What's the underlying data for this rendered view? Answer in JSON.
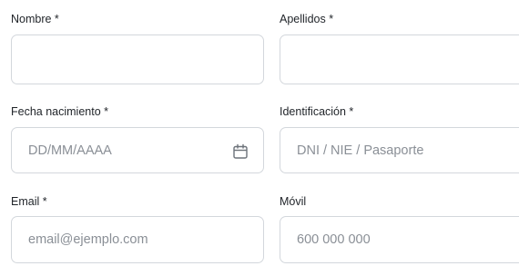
{
  "fields": {
    "nombre": {
      "label": "Nombre *",
      "value": "",
      "placeholder": ""
    },
    "apellidos": {
      "label": "Apellidos *",
      "value": "",
      "placeholder": ""
    },
    "fecha_nacimiento": {
      "label": "Fecha nacimiento *",
      "value": "",
      "placeholder": "DD/MM/AAAA",
      "icon": "calendar-icon"
    },
    "identificacion": {
      "label": "Identificación *",
      "value": "",
      "placeholder": "DNI / NIE / Pasaporte"
    },
    "email": {
      "label": "Email *",
      "value": "",
      "placeholder": "email@ejemplo.com"
    },
    "movil": {
      "label": "Móvil",
      "value": "",
      "placeholder": "600 000 000"
    }
  },
  "colors": {
    "border": "#d3d7dc",
    "label": "#1f2328",
    "placeholder": "#8a8f96",
    "icon": "#6d737a"
  }
}
